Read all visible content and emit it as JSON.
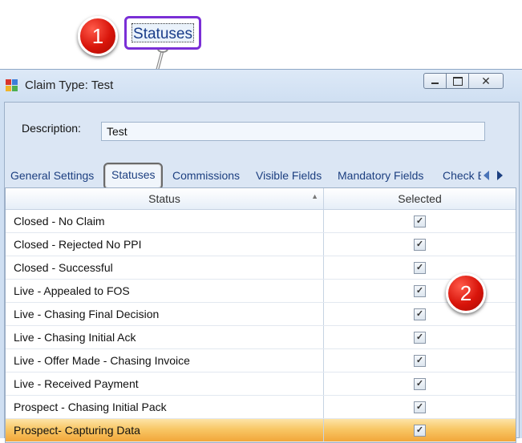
{
  "annotations": {
    "step1": "1",
    "step2": "2",
    "zoomed_tab_label": "Statuses"
  },
  "window": {
    "title": "Claim Type: Test",
    "controls": {
      "close_glyph": "✕"
    }
  },
  "form": {
    "description_label": "Description:",
    "description_value": "Test"
  },
  "tabs": [
    {
      "label": "General Settings"
    },
    {
      "label": "Statuses"
    },
    {
      "label": "Commissions"
    },
    {
      "label": "Visible Fields"
    },
    {
      "label": "Mandatory Fields"
    },
    {
      "label": "Check B"
    }
  ],
  "grid": {
    "columns": {
      "status": "Status",
      "selected": "Selected"
    },
    "rows": [
      {
        "status": "Closed - No Claim",
        "selected": "✓"
      },
      {
        "status": "Closed - Rejected No PPI",
        "selected": "✓"
      },
      {
        "status": "Closed - Successful",
        "selected": "✓"
      },
      {
        "status": "Live - Appealed to FOS",
        "selected": "✓"
      },
      {
        "status": "Live - Chasing Final Decision",
        "selected": "✓"
      },
      {
        "status": "Live - Chasing Initial Ack",
        "selected": "✓"
      },
      {
        "status": "Live - Offer Made - Chasing Invoice",
        "selected": "✓"
      },
      {
        "status": "Live - Received Payment",
        "selected": "✓"
      },
      {
        "status": "Prospect - Chasing Initial Pack",
        "selected": "✓"
      },
      {
        "status": "Prospect- Capturing Data",
        "selected": "✓"
      }
    ]
  },
  "colors": {
    "annotation_red": "#d8140a",
    "highlight_purple": "#7a2fd6",
    "selected_row": "#f8c766"
  }
}
